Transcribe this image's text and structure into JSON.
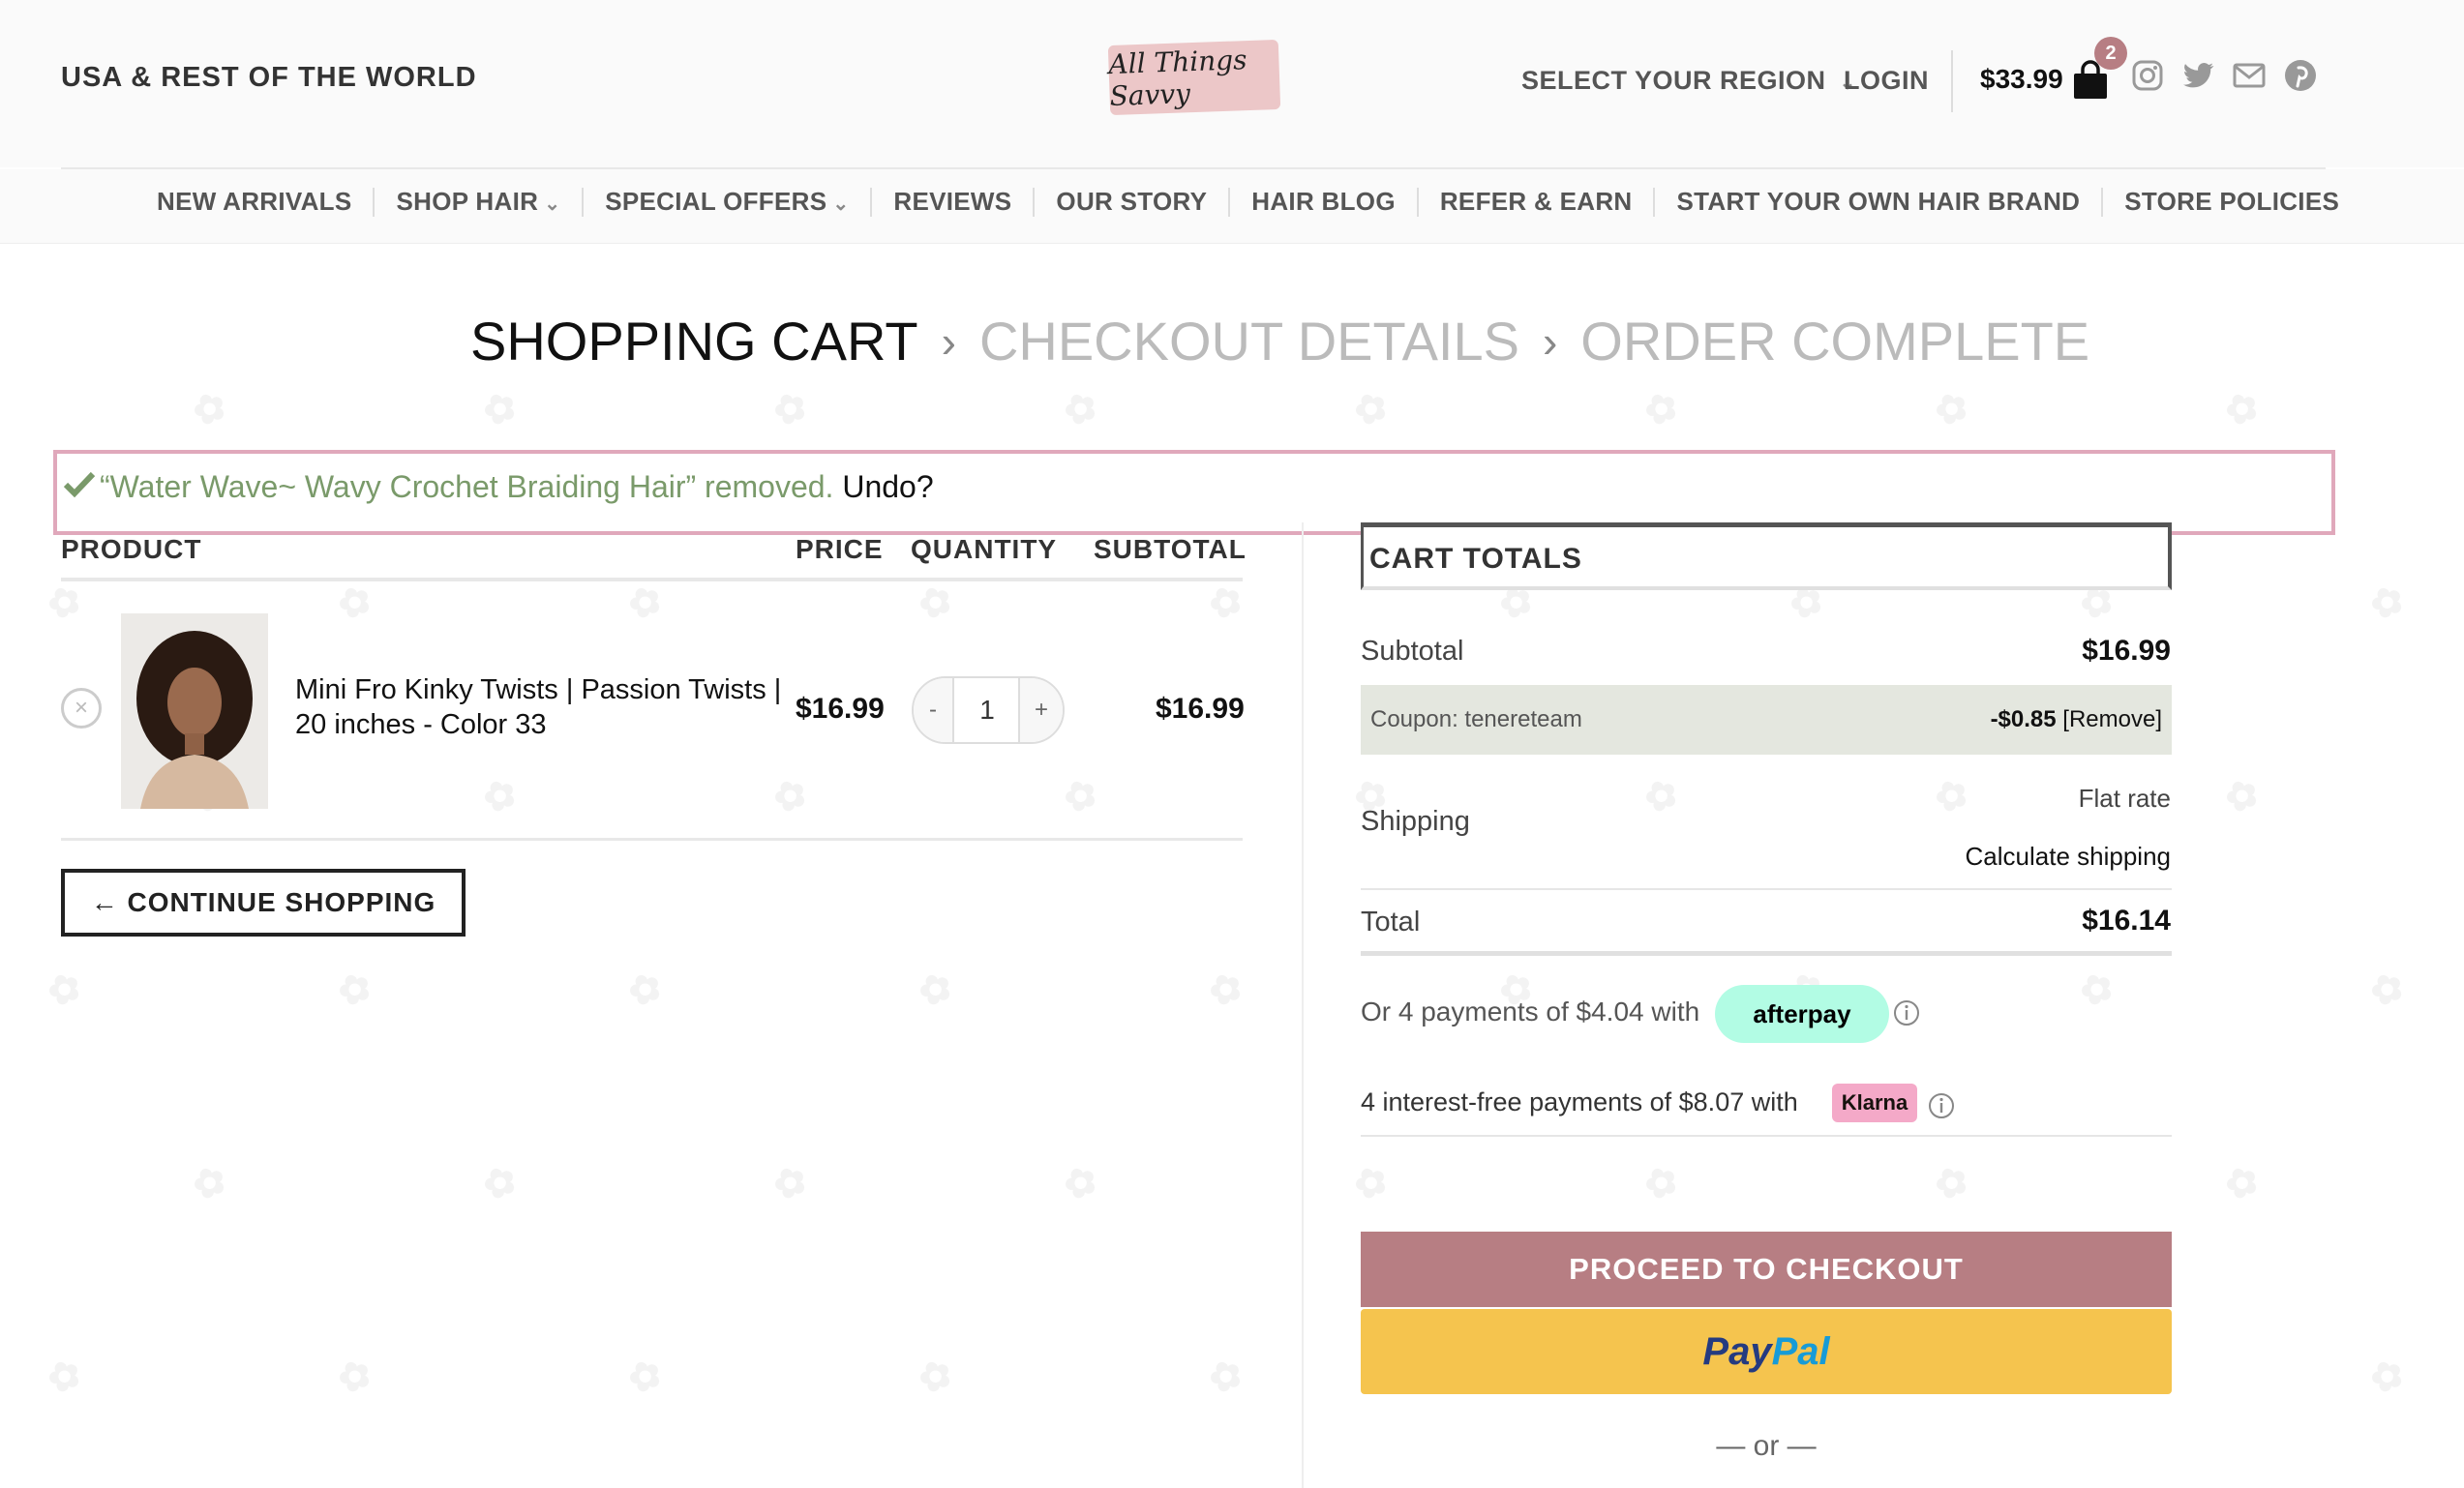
{
  "header": {
    "region_title": "USA & REST OF THE WORLD",
    "logo_text": "All Things Savvy",
    "select_region": "SELECT YOUR REGION",
    "login": "LOGIN",
    "cart_total": "$33.99",
    "cart_count": "2",
    "social_icons": [
      "instagram-icon",
      "twitter-icon",
      "email-icon",
      "pinterest-icon"
    ]
  },
  "nav": {
    "items": [
      {
        "label": "NEW ARRIVALS"
      },
      {
        "label": "SHOP HAIR"
      },
      {
        "label": "SPECIAL OFFERS"
      },
      {
        "label": "REVIEWS"
      },
      {
        "label": "OUR STORY"
      },
      {
        "label": "HAIR BLOG"
      },
      {
        "label": "REFER & EARN"
      },
      {
        "label": "START YOUR OWN HAIR BRAND"
      },
      {
        "label": "STORE POLICIES"
      }
    ]
  },
  "steps": {
    "cart": "SHOPPING CART",
    "details": "CHECKOUT DETAILS",
    "complete": "ORDER COMPLETE"
  },
  "notice": {
    "message": "“Water Wave~ Wavy Crochet Braiding Hair” removed.",
    "undo": "Undo?"
  },
  "cart": {
    "headers": {
      "product": "PRODUCT",
      "price": "PRICE",
      "quantity": "QUANTITY",
      "subtotal": "SUBTOTAL"
    },
    "item": {
      "name": "Mini Fro Kinky Twists | Passion Twists | 20 inches - Color 33",
      "price": "$16.99",
      "quantity": "1",
      "subtotal": "$16.99"
    },
    "continue_label": "← CONTINUE SHOPPING"
  },
  "totals": {
    "title": "CART TOTALS",
    "subtotal_label": "Subtotal",
    "subtotal_value": "$16.99",
    "coupon_label": "Coupon: tenereteam",
    "coupon_amount": "-$0.85",
    "coupon_remove": "[Remove]",
    "shipping_label": "Shipping",
    "shipping_method": "Flat rate",
    "shipping_calc": "Calculate shipping",
    "total_label": "Total",
    "total_value": "$16.14",
    "afterpay_text": "Or 4 payments of $4.04 with",
    "afterpay_brand": "afterpay",
    "klarna_text": "4 interest-free payments of $8.07 with",
    "klarna_brand": "Klarna",
    "checkout_label": "PROCEED TO CHECKOUT",
    "paypal_part1": "Pay",
    "paypal_part2": "Pal",
    "or_text": "— or —"
  },
  "colors": {
    "accent": "#b77e83",
    "notice_border": "#e0a8bb",
    "notice_text": "#7a9a6a",
    "paypal_yellow": "#f5c44e",
    "afterpay_mint": "#b2fce4",
    "klarna_pink": "#f4a9c8"
  }
}
